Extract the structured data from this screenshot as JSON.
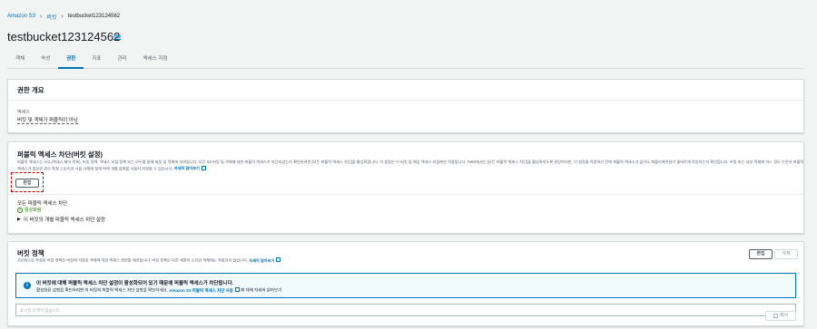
{
  "breadcrumb": {
    "items": [
      "Amazon S3",
      "버킷",
      "testbucket123124562"
    ]
  },
  "page": {
    "title": "testbucket123124562",
    "info_label": "정보"
  },
  "tabs": [
    {
      "label": "객체",
      "active": false
    },
    {
      "label": "속성",
      "active": false
    },
    {
      "label": "권한",
      "active": true
    },
    {
      "label": "지표",
      "active": false
    },
    {
      "label": "관리",
      "active": false
    },
    {
      "label": "액세스 지점",
      "active": false
    }
  ],
  "overview": {
    "title": "권한 개요",
    "access_label": "액세스",
    "access_value": "버킷 및 객체가 퍼블릭이 아님"
  },
  "block_public_access": {
    "title": "퍼블릭 액세스 차단(버킷 설정)",
    "description": "퍼블릭 액세스는 ACL(액세스 제어 목록), 버킷 정책, 액세스 지점 정책 또는 모두를 통해 버킷 및 객체에 부여됩니다. 모든 S3 버킷 및 객체에 대한 퍼블릭 액세스가 차단되었는지 확인하려면 [모든 퍼블릭 액세스 차단]을 활성화합니다. 이 설정은 이 버킷 및 해당 액세스 지점에만 적용됩니다. AWS에서는 [모든 퍼블릭 액세스 차단]을 활성화하도록 권장하지만, 이 설정을 적용하기 전에 퍼블릭 액세스가 없어도 애플리케이션이 올바르게 작동하는지 확인합니다. 버킷 또는 내부 객체에 어느 정도 수준의 퍼블릭 액세스가 필요한 경우 특정 스토리지 사용 사례에 맞게 아래 개별 설정을 사용자 지정할 수 있습니다.",
    "learn_more": "자세히 알아보기",
    "edit_label": "편집",
    "status_label": "모든 퍼블릭 액세스 차단",
    "status_value": "활성화됨",
    "expand_label": "이 버킷의 개별 퍼블릭 액세스 차단 설정"
  },
  "bucket_policy": {
    "title": "버킷 정책",
    "description": "JSON으로 작성된 버킷 정책은 버킷에 저장된 객체에 대한 액세스 권한을 제공합니다. 버킷 정책은 다른 계정이 소유한 객체에는 적용되지 않습니다.",
    "learn_more": "자세히 알아보기",
    "edit_label": "편집",
    "delete_label": "삭제",
    "alert_title": "이 버킷에 대해 퍼블릭 액세스 차단 설정이 활성화되어 있기 때문에 퍼블릭 액세스가 차단됩니다.",
    "alert_text_prefix": "활성화된 설정을 확인하려면 이 버킷의 퍼블릭 액세스 차단 설정을 확인하세요.",
    "alert_link": "Amazon S3 퍼블릭 액세스 차단 사용",
    "alert_text_suffix": "에 대해 자세히 알아보기",
    "empty_text": "표시할 정책이 없습니다.",
    "copy_label": "복사"
  },
  "colors": {
    "link": "#0073bb",
    "success": "#1d8102",
    "highlight": "#cc0000"
  }
}
